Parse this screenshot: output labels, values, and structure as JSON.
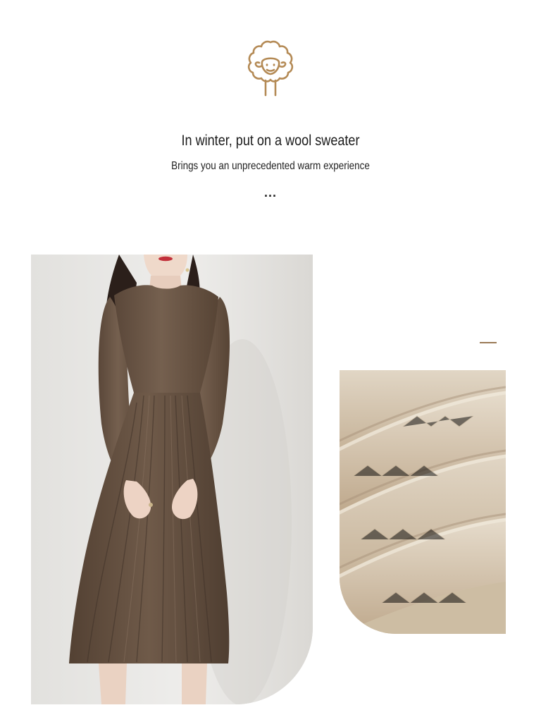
{
  "brand": {
    "logo_icon": "sheep-icon",
    "accent_color": "#b48a55"
  },
  "hero": {
    "headline": "In winter, put on a wool sweater",
    "subheadline": "Brings you an unprecedented warm experience",
    "ellipsis": "..."
  },
  "images": {
    "model_photo": "model-in-brown-knit-dress",
    "fabric_photo": "wool-fabric-closeup"
  },
  "colors": {
    "dress": "#6b5646",
    "fabric": "#d5c6ae",
    "wall": "#e6e5e2"
  }
}
